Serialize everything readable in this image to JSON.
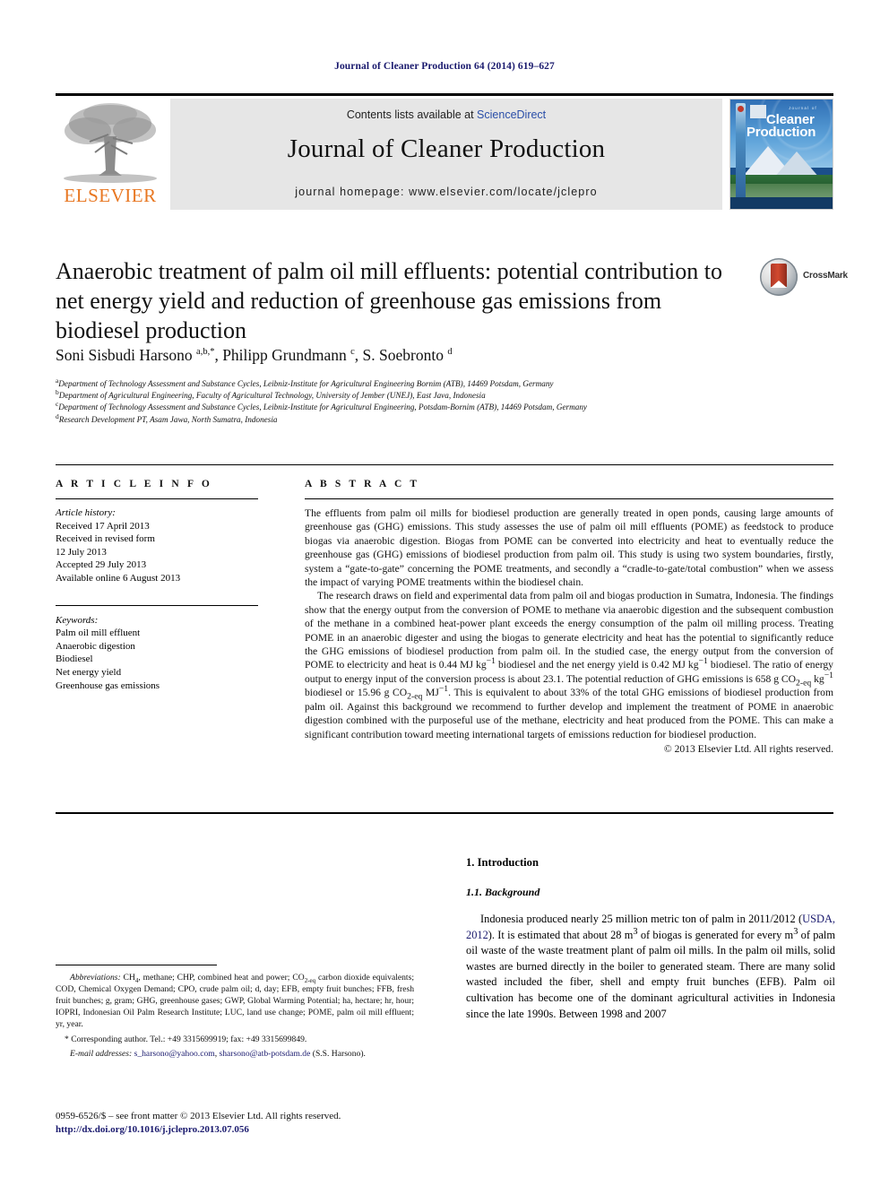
{
  "running_head": "Journal of Cleaner Production 64 (2014) 619–627",
  "masthead": {
    "publisher_name": "ELSEVIER",
    "contents_prefix": "Contents lists available at ",
    "contents_link": "ScienceDirect",
    "journal_name": "Journal of Cleaner Production",
    "homepage": "journal homepage: www.elsevier.com/locate/jclepro",
    "cover": {
      "journal_of": "Journal of",
      "line1": "Cleaner",
      "line2": "Production"
    }
  },
  "article": {
    "title": "Anaerobic treatment of palm oil mill effluents: potential contribution to net energy yield and reduction of greenhouse gas emissions from biodiesel production",
    "crossmark_label": "CrossMark",
    "authors_html": "Soni Sisbudi Harsono <sup>a,b,*</sup>, Philipp Grundmann <sup>c</sup>, S. Soebronto <sup>d</sup>",
    "affiliations": [
      {
        "marker": "a",
        "text": "Department of Technology Assessment and Substance Cycles, Leibniz-Institute for Agricultural Engineering Bornim (ATB), 14469 Potsdam, Germany"
      },
      {
        "marker": "b",
        "text": "Department of Agricultural Engineering, Faculty of Agricultural Technology, University of Jember (UNEJ), East Java, Indonesia"
      },
      {
        "marker": "c",
        "text": "Department of Technology Assessment and Substance Cycles, Leibniz-Institute for Agricultural Engineering, Potsdam-Bornim (ATB), 14469 Potsdam, Germany"
      },
      {
        "marker": "d",
        "text": "Research Development PT, Asam Jawa, North Sumatra, Indonesia"
      }
    ]
  },
  "article_info": {
    "heading": "A R T I C L E  I N F O",
    "history_label": "Article history:",
    "history": [
      "Received 17 April 2013",
      "Received in revised form",
      "12 July 2013",
      "Accepted 29 July 2013",
      "Available online 6 August 2013"
    ],
    "keywords_label": "Keywords:",
    "keywords": [
      "Palm oil mill effluent",
      "Anaerobic digestion",
      "Biodiesel",
      "Net energy yield",
      "Greenhouse gas emissions"
    ]
  },
  "abstract": {
    "heading": "A B S T R A C T",
    "paragraph1": "The effluents from palm oil mills for biodiesel production are generally treated in open ponds, causing large amounts of greenhouse gas (GHG) emissions. This study assesses the use of palm oil mill effluents (POME) as feedstock to produce biogas via anaerobic digestion. Biogas from POME can be converted into electricity and heat to eventually reduce the greenhouse gas (GHG) emissions of biodiesel production from palm oil. This study is using two system boundaries, firstly, system a “gate-to-gate” concerning the POME treatments, and secondly a “cradle-to-gate/total combustion” when we assess the impact of varying POME treatments within the biodiesel chain.",
    "paragraph2_html": "The research draws on field and experimental data from palm oil and biogas production in Sumatra, Indonesia. The findings show that the energy output from the conversion of POME to methane via anaerobic digestion and the subsequent combustion of the methane in a combined heat-power plant exceeds the energy consumption of the palm oil milling process. Treating POME in an anaerobic digester and using the biogas to generate electricity and heat has the potential to significantly reduce the GHG emissions of biodiesel production from palm oil. In the studied case, the energy output from the conversion of POME to electricity and heat is 0.44 MJ kg<sup>−1</sup> biodiesel and the net energy yield is 0.42 MJ kg<sup>−1</sup> biodiesel. The ratio of energy output to energy input of the conversion process is about 23.1. The potential reduction of GHG emissions is 658 g CO<sub>2-eq</sub> kg<sup>−1</sup> biodiesel or 15.96 g CO<sub>2-eq</sub> MJ<sup>−1</sup>. This is equivalent to about 33% of the total GHG emissions of biodiesel production from palm oil. Against this background we recommend to further develop and implement the treatment of POME in anaerobic digestion combined with the purposeful use of the methane, electricity and heat produced from the POME. This can make a significant contribution toward meeting international targets of emissions reduction for biodiesel production.",
    "copyright": "© 2013 Elsevier Ltd. All rights reserved."
  },
  "introduction": {
    "section_number_title": "1. Introduction",
    "subsection_title": "1.1. Background",
    "paragraph_html": "Indonesia produced nearly 25 million metric ton of palm in 2011/2012 (<span class=\"cite\">USDA, 2012</span>). It is estimated that about 28 m<sup>3</sup> of biogas is generated for every m<sup>3</sup> of palm oil waste of the waste treatment plant of palm oil mills. In the palm oil mills, solid wastes are burned directly in the boiler to generated steam. There are many solid wasted included the fiber, shell and empty fruit bunches (EFB). Palm oil cultivation has become one of the dominant agricultural activities in Indonesia since the late 1990s. Between 1998 and 2007"
  },
  "footnotes": {
    "abbreviations_html": "<i>Abbreviations:</i> CH<sub>4</sub>, methane; CHP, combined heat and power; CO<sub>2-eq</sub> carbon dioxide equivalents; COD, Chemical Oxygen Demand; CPO, crude palm oil; d, day; EFB, empty fruit bunches; FFB, fresh fruit bunches; g, gram; GHG, greenhouse gases; GWP, Global Warming Potential; ha, hectare; hr, hour; IOPRI, Indonesian Oil Palm Research Institute; LUC, land use change; POME, palm oil mill effluent; yr, year.",
    "corresponding_html": "* Corresponding author. Tel.: +49 3315699919; fax: +49 3315699849.",
    "email_label": "E-mail addresses:",
    "email1": "s_harsono@yahoo.com",
    "email2": "sharsono@atb-potsdam.de",
    "email_owner": "(S.S. Harsono)."
  },
  "footer": {
    "issn_line": "0959-6526/$ – see front matter © 2013 Elsevier Ltd. All rights reserved.",
    "doi": "http://dx.doi.org/10.1016/j.jclepro.2013.07.056"
  },
  "colors": {
    "elsevier_orange": "#e87722",
    "link_blue": "#1a1a6e",
    "sciencedirect_blue": "#2a4ea8",
    "masthead_gray": "#e6e6e6"
  }
}
